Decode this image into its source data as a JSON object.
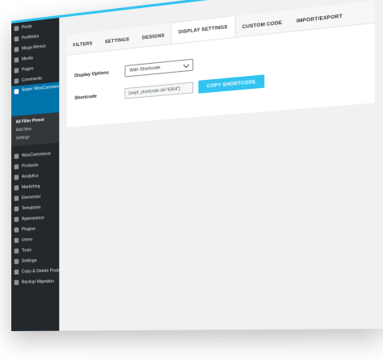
{
  "sidebar": {
    "items_top": [
      {
        "label": "Posts",
        "icon": "pin-icon"
      },
      {
        "label": "Portfolios",
        "icon": "portfolio-icon"
      },
      {
        "label": "Mega Menus",
        "icon": "menu-icon"
      },
      {
        "label": "Media",
        "icon": "media-icon"
      },
      {
        "label": "Pages",
        "icon": "page-icon"
      },
      {
        "label": "Comments",
        "icon": "comment-icon"
      }
    ],
    "active_item": {
      "label": "Super WooCommerce Product Filter",
      "icon": "filter-icon"
    },
    "submenu": [
      {
        "label": "All Filter Preset",
        "current": true
      },
      {
        "label": "Add New"
      },
      {
        "label": "Settings"
      }
    ],
    "items_bottom": [
      {
        "label": "WooCommerce",
        "icon": "woocommerce-icon"
      },
      {
        "label": "Products",
        "icon": "products-icon"
      },
      {
        "label": "Analytics",
        "icon": "analytics-icon"
      },
      {
        "label": "Marketing",
        "icon": "megaphone-icon"
      },
      {
        "label": "Elementor",
        "icon": "elementor-icon"
      },
      {
        "label": "Templates",
        "icon": "templates-icon"
      },
      {
        "label": "Appearance",
        "icon": "brush-icon"
      },
      {
        "label": "Plugins",
        "icon": "plugin-icon"
      },
      {
        "label": "Users",
        "icon": "users-icon"
      },
      {
        "label": "Tools",
        "icon": "wrench-icon"
      },
      {
        "label": "Settings",
        "icon": "settings-icon"
      },
      {
        "label": "Copy & Delete Posts",
        "icon": "copy-icon"
      },
      {
        "label": "Backup Migration",
        "icon": "backup-icon"
      }
    ]
  },
  "tabs": [
    {
      "label": "FILTERS",
      "active": false
    },
    {
      "label": "SETTINGS",
      "active": false
    },
    {
      "label": "DESIGNS",
      "active": false
    },
    {
      "label": "DISPLAY SETTINGS",
      "active": true
    },
    {
      "label": "CUSTOM CODE",
      "active": false
    },
    {
      "label": "IMPORT/EXPORT",
      "active": false
    }
  ],
  "display_options": {
    "label": "Display Options",
    "selected": "With Shortcode"
  },
  "shortcode": {
    "label": "Shortcode",
    "value": "[swpf_shortcode id=\"6364\"]",
    "copy_button": "COPY SHORTCODE"
  },
  "colors": {
    "accent": "#33c3f0",
    "sidebar_bg": "#23282d",
    "active_menu": "#0073aa"
  }
}
